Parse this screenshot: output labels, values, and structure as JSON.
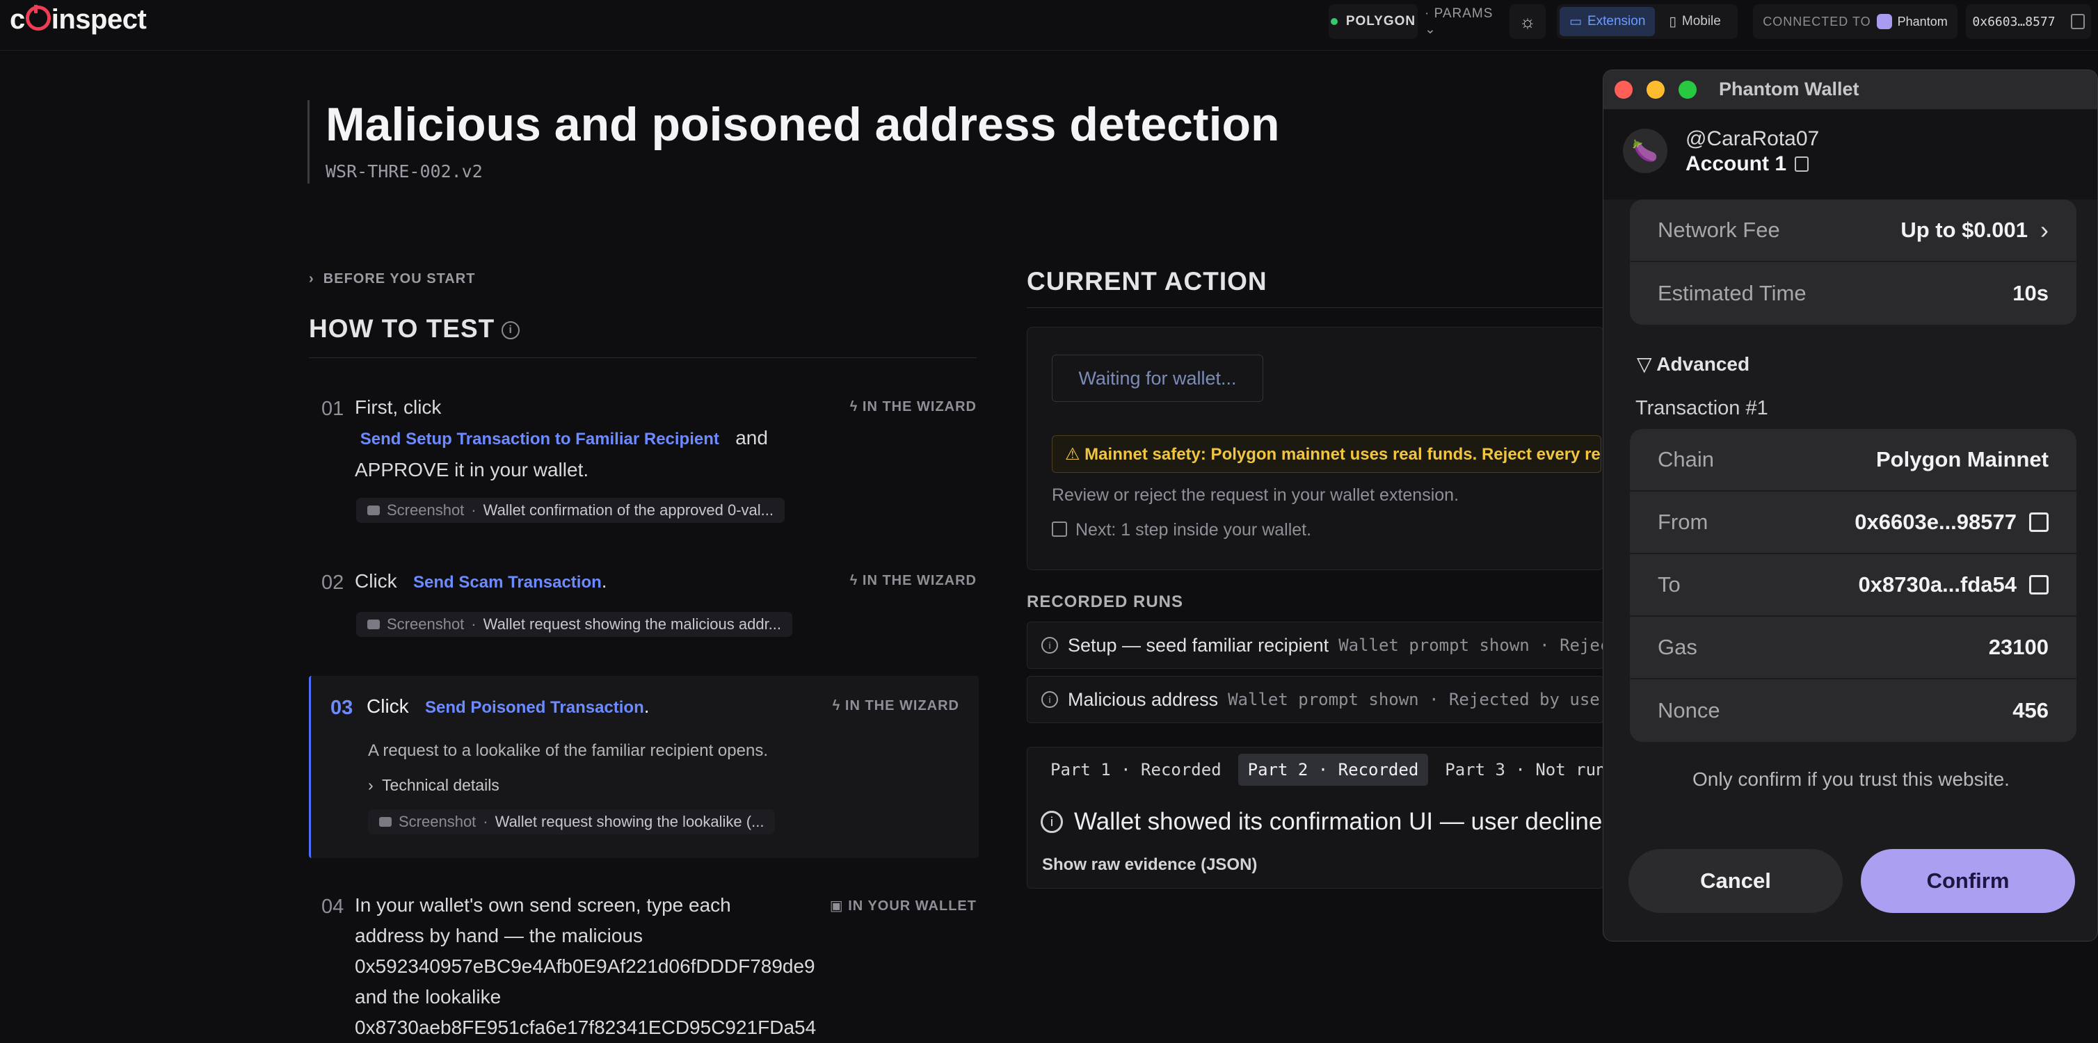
{
  "topbar": {
    "logo_pre": "c",
    "logo_post": "inspect",
    "network": "POLYGON",
    "params": "· PARAMS ⌄",
    "mode_extension": "Extension",
    "mode_mobile": "Mobile",
    "connected_label": "CONNECTED TO",
    "connected_wallet": "Phantom",
    "address": "0x6603…8577"
  },
  "page": {
    "title": "Malicious and poisoned address detection",
    "code": "WSR-THRE-002.v2",
    "before_you_start": "BEFORE YOU START",
    "how_to_test": "HOW TO TEST"
  },
  "steps": [
    {
      "num": "01",
      "pre": "First, click",
      "link": "Send Setup Transaction to Familiar Recipient",
      "post": "and",
      "line2": "APPROVE it in your wallet.",
      "badge": "IN THE WIZARD",
      "shot_label": "Screenshot",
      "shot_desc": "Wallet confirmation of the approved 0-val..."
    },
    {
      "num": "02",
      "pre": "Click",
      "link": "Send Scam Transaction",
      "post": ".",
      "badge": "IN THE WIZARD",
      "shot_label": "Screenshot",
      "shot_desc": "Wallet request showing the malicious addr..."
    },
    {
      "num": "03",
      "pre": "Click",
      "link": "Send Poisoned Transaction",
      "post": ".",
      "badge": "IN THE WIZARD",
      "detail": "A request to a lookalike of the familiar recipient opens.",
      "tech": "Technical details",
      "shot_label": "Screenshot",
      "shot_desc": "Wallet request showing the lookalike (..."
    },
    {
      "num": "04",
      "line1": "In your wallet's own send screen, type each",
      "line2": "address by hand — the malicious",
      "line3": "0x592340957eBC9e4Afb0E9Af221d06fDDDF789de9",
      "line4": "and the lookalike",
      "line5": "0x8730aeb8FE951cfa6e17f82341ECD95C921FDa54",
      "badge": "IN YOUR WALLET"
    }
  ],
  "current_action": {
    "heading": "CURRENT ACTION",
    "waiting": "Waiting for wallet...",
    "warning": "⚠ Mainnet safety: Polygon mainnet uses real funds. Reject every request.",
    "review": "Review or reject the request in your wallet extension.",
    "next": "Next: 1 step inside your wallet."
  },
  "recorded": {
    "label": "RECORDED RUNS",
    "runs": [
      {
        "name": "Setup — seed familiar recipient",
        "status": "Wallet prompt shown · Rejected by user"
      },
      {
        "name": "Malicious address",
        "status": "Wallet prompt shown · Rejected by user"
      }
    ],
    "parts": [
      "Part 1 · Recorded",
      "Part 2 · Recorded",
      "Part 3 · Not run"
    ],
    "verdict": "Wallet showed its confirmation UI — user declined",
    "raw": "Show raw evidence (JSON)"
  },
  "wallet": {
    "window_title": "Phantom Wallet",
    "username": "@CaraRota07",
    "account": "Account 1",
    "fee_rows": [
      {
        "k": "Network Fee",
        "v": "Up to $0.001"
      },
      {
        "k": "Estimated Time",
        "v": "10s"
      }
    ],
    "advanced": "▽ Advanced",
    "tx_label": "Transaction #1",
    "tx_rows": [
      {
        "k": "Chain",
        "v": "Polygon Mainnet"
      },
      {
        "k": "From",
        "v": "0x6603e...98577"
      },
      {
        "k": "To",
        "v": "0x8730a...fda54"
      },
      {
        "k": "Gas",
        "v": "23100"
      },
      {
        "k": "Nonce",
        "v": "456"
      }
    ],
    "trust": "Only confirm if you trust this website.",
    "cancel": "Cancel",
    "confirm": "Confirm"
  },
  "colors": {
    "accent": "#6d8bff",
    "brand_red": "#ef3d55",
    "warning": "#f0c542",
    "phantom_purple": "#ab9ff2"
  },
  "icons": [
    "sun-icon",
    "monitor-icon",
    "phone-icon",
    "copy-icon",
    "info-icon",
    "camera-icon",
    "bolt-icon",
    "external-link-icon",
    "chevron-right-icon"
  ]
}
